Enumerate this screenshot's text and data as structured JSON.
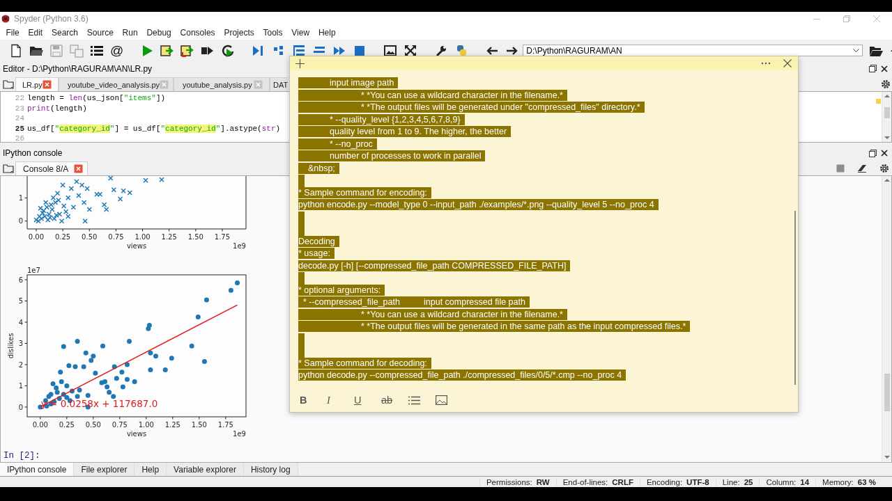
{
  "window": {
    "title": "Spyder (Python 3.6)"
  },
  "menu": [
    "File",
    "Edit",
    "Search",
    "Source",
    "Run",
    "Debug",
    "Consoles",
    "Projects",
    "Tools",
    "View",
    "Help"
  ],
  "toolbar": {
    "glyph": "@",
    "working_directory": "D:\\Python\\RAGURAM\\AN"
  },
  "editor": {
    "title": "Editor - D:\\Python\\RAGURAM\\AN\\LR.py",
    "tabs": [
      {
        "label": "LR.py",
        "selected": true
      },
      {
        "label": "youtube_video_analysis.py",
        "selected": false
      },
      {
        "label": "youtube_analysis.py",
        "selected": false
      },
      {
        "label": "DAT",
        "selected": false,
        "kind": "truncated"
      }
    ],
    "lines": [
      {
        "number": "22",
        "current": false,
        "tokens": [
          {
            "text": "length = ",
            "kind": "plain"
          },
          {
            "text": "len",
            "kind": "builtin"
          },
          {
            "text": "(us_json[",
            "kind": "plain"
          },
          {
            "text": "\"items\"",
            "kind": "string"
          },
          {
            "text": "])",
            "kind": "plain"
          }
        ]
      },
      {
        "number": "23",
        "current": false,
        "tokens": [
          {
            "text": "print",
            "kind": "builtin"
          },
          {
            "text": "(length)",
            "kind": "plain"
          }
        ]
      },
      {
        "number": "24",
        "current": false
      },
      {
        "number": "25",
        "current": true,
        "tokens": [
          {
            "text": "us_df[",
            "kind": "plain"
          },
          {
            "text": "\"",
            "kind": "string"
          },
          {
            "text": "category_id",
            "kind": "occurrence"
          },
          {
            "text": "\"",
            "kind": "string"
          },
          {
            "text": "] = us_df[",
            "kind": "plain"
          },
          {
            "text": "\"",
            "kind": "string"
          },
          {
            "text": "category_id",
            "kind": "occurrence"
          },
          {
            "text": "\"",
            "kind": "string"
          },
          {
            "text": "].astype(",
            "kind": "plain"
          },
          {
            "text": "str",
            "kind": "builtin"
          },
          {
            "text": ")",
            "kind": "plain"
          }
        ]
      },
      {
        "number": "26",
        "current": false
      }
    ]
  },
  "console": {
    "title": "IPython console",
    "tabs": [
      {
        "label": "Console 8/A",
        "selected": true
      }
    ],
    "plots": [
      {
        "x_offset": "1e9",
        "chart_data": {
          "type": "scatter",
          "xlabel": "views",
          "xlim": [
            -0.085,
            1.973
          ],
          "ylim": [
            -0.34,
            1.94
          ],
          "xticks": [
            {
              "value": 0,
              "label": "0.00"
            },
            {
              "value": 0.25,
              "label": "0.25"
            },
            {
              "value": 0.5,
              "label": "0.50"
            },
            {
              "value": 0.75,
              "label": "0.75"
            },
            {
              "value": 1,
              "label": "1.00"
            },
            {
              "value": 1.25,
              "label": "1.25"
            },
            {
              "value": 1.5,
              "label": "1.50"
            },
            {
              "value": 1.75,
              "label": "1.75"
            }
          ],
          "yticks": [
            0,
            1
          ],
          "series": [
            {
              "color": "#1f77b4",
              "marker": "x",
              "x": [
                1.03,
                1.18,
                0.88,
                0.82,
                0.79,
                0.73,
                0.66,
                0.64,
                0.6,
                0.57,
                0.5,
                0.46,
                0.45,
                0.4,
                0.35,
                0.3,
                0.25,
                0.2,
                0.18,
                0.15,
                0.12,
                0.1,
                0.08,
                0.05,
                0.02,
                0.0,
                0.22,
                0.28,
                0.33,
                0.38,
                0.43,
                0.48,
                0.7,
                0.16,
                0.06,
                0.13,
                0.24,
                0.3,
                0.03,
                0.07,
                0.11,
                0.14,
                0.19,
                0.09,
                0.04,
                0.26,
                0.21,
                0.17
              ],
              "values": [
                1.75,
                1.78,
                1.22,
                1.3,
                0.95,
                1.35,
                0.5,
                0.7,
                1.15,
                1.15,
                0.5,
                0.0,
                0.8,
                1.1,
                0.6,
                1.0,
                1.55,
                1.2,
                0.8,
                0.5,
                0.3,
                0.6,
                0.2,
                0.1,
                0.0,
                0.05,
                0.3,
                0.4,
                1.4,
                1.7,
                1.55,
                1.4,
                1.85,
                1.0,
                0.35,
                0.15,
                0.0,
                0.2,
                0.2,
                0.45,
                0.05,
                0.7,
                0.25,
                0.8,
                0.55,
                0.65,
                0.9,
                0.1
              ]
            }
          ]
        }
      },
      {
        "x_offset": "1e9",
        "y_offset": "1e7",
        "chart_data": {
          "type": "scatter",
          "xlabel": "views",
          "ylabel": "dislikes",
          "xlim": [
            -0.124,
            1.942
          ],
          "ylim": [
            -0.46,
            6.23
          ],
          "xticks": [
            {
              "value": 0,
              "label": "0.00"
            },
            {
              "value": 0.25,
              "label": "0.25"
            },
            {
              "value": 0.5,
              "label": "0.50"
            },
            {
              "value": 0.75,
              "label": "0.75"
            },
            {
              "value": 1,
              "label": "1.00"
            },
            {
              "value": 1.25,
              "label": "1.25"
            },
            {
              "value": 1.5,
              "label": "1.50"
            },
            {
              "value": 1.75,
              "label": "1.75"
            }
          ],
          "yticks": [
            0,
            1,
            2,
            3,
            4,
            5,
            6
          ],
          "series": [
            {
              "color": "#1f77b4",
              "marker": "o",
              "x": [
                1.86,
                1.8,
                1.57,
                1.49,
                1.03,
                1.02,
                0.84,
                0.35,
                0.22,
                0.59,
                1.43,
                1.55,
                1.24,
                1.09,
                1.04,
                0.43,
                0.5,
                0.48,
                0.19,
                0.27,
                0.33,
                0.41,
                0.52,
                0.7,
                0.82,
                0.77,
                1.04,
                1.18,
                0.58,
                0.61,
                0.72,
                0.82,
                0.89,
                0.78,
                0.63,
                0.65,
                0.69,
                0.45,
                0.37,
                0.3,
                0.25,
                0.2,
                0.15,
                0.1,
                0.12,
                0.05,
                0.08,
                0.02,
                0.0,
                0.04,
                0.18,
                0.22,
                0.28,
                0.35,
                0.45,
                0.13,
                0.06,
                0.1,
                0.16,
                0.25
              ],
              "values": [
                5.85,
                5.5,
                5.05,
                4.25,
                3.85,
                3.7,
                3.1,
                3.1,
                2.85,
                2.88,
                2.88,
                2.15,
                2.3,
                2.4,
                2.55,
                2.55,
                2.4,
                2.2,
                1.65,
                1.95,
                1.9,
                1.9,
                1.6,
                1.9,
                2.0,
                1.65,
                1.75,
                1.75,
                1.15,
                1.2,
                1.35,
                1.3,
                1.2,
                0.95,
                0.95,
                0.7,
                0.5,
                0.55,
                0.8,
                0.75,
                1.0,
                1.2,
                0.9,
                0.6,
                1.1,
                0.3,
                0.5,
                null,
                0.0,
                null,
                0.4,
                0.6,
                0.3,
                0.5,
                0.0,
                0.25,
                0.05,
                0.15,
                0.7,
                0.45
              ]
            },
            {
              "color": "#e31a1c",
              "type": "line",
              "x": [
                0,
                1.86
              ],
              "values": [
                0.01,
                4.81
              ]
            }
          ],
          "annotations": [
            {
              "text": "y = 0.0258x + 117687.0",
              "x": 0.0,
              "y": 0.0
            }
          ]
        }
      }
    ],
    "prompt": "In [2]:"
  },
  "bottom_tabs": [
    {
      "label": "IPython console",
      "selected": true
    },
    {
      "label": "File explorer",
      "selected": false
    },
    {
      "label": "Help",
      "selected": false
    },
    {
      "label": "Variable explorer",
      "selected": false
    },
    {
      "label": "History log",
      "selected": false
    }
  ],
  "status_bar": [
    {
      "label": "Permissions:",
      "value": "RW"
    },
    {
      "label": "End-of-lines:",
      "value": "CRLF"
    },
    {
      "label": "Encoding:",
      "value": "UTF-8"
    },
    {
      "label": "Line:",
      "value": "25"
    },
    {
      "label": "Column:",
      "value": "14"
    },
    {
      "label": "Memory:",
      "value": "63 %"
    }
  ],
  "note": {
    "lines": [
      {
        "text": "\tinput image path",
        "selected": true
      },
      {
        "text": "\t\t* *You can use a wildcard character in the filename.*",
        "selected": true
      },
      {
        "text": "\t\t* *The output files will be generated under \"compressed_files\" directory.*",
        "selected": true
      },
      {
        "text": "\t* --quality_level {1,2,3,4,5,6,7,8,9}",
        "selected": true
      },
      {
        "text": "\tquality level from 1 to 9. The higher, the better",
        "selected": true
      },
      {
        "text": "\t* --no_proc",
        "selected": true
      },
      {
        "text": "\tnumber of processes to work in parallel",
        "selected": true
      },
      {
        "text": "    &nbsp;",
        "selected": true
      },
      {
        "kind": "blank",
        "selected": true
      },
      {
        "text": "* Sample command for encoding:",
        "selected": true
      },
      {
        "text": "python encode.py --model_type 0 --input_path ./examples/*.png --quality_level 5 --no_proc 4",
        "selected": true
      },
      {
        "kind": "blank",
        "selected": true
      },
      {
        "kind": "blank",
        "selected": true
      },
      {
        "text": "Decoding",
        "selected": true
      },
      {
        "text": "* usage:",
        "selected": true
      },
      {
        "text": "decode.py [-h] [--compressed_file_path COMPRESSED_FILE_PATH]",
        "selected": true
      },
      {
        "kind": "blank",
        "selected": true
      },
      {
        "text": "* optional arguments:",
        "selected": true
      },
      {
        "text": "  * --compressed_file_path\tinput compressed file path",
        "selected": true
      },
      {
        "text": "\t\t* *You can use a wildcard character in the filename.*",
        "selected": true
      },
      {
        "text": "\t\t* *The output files will be generated in the same path as the input compressed files.*",
        "selected": true
      },
      {
        "kind": "blank",
        "selected": true
      },
      {
        "kind": "blank",
        "selected": true
      },
      {
        "text": "* Sample command for decoding:",
        "selected": true
      },
      {
        "text": "python decode.py --compressed_file_path ./compressed_files/0/5/*.cmp --no_proc 4",
        "selected": true
      }
    ],
    "format_buttons": [
      {
        "label": "B",
        "kind": "bold"
      },
      {
        "label": "I",
        "kind": "italic"
      },
      {
        "label": "U",
        "kind": "underline"
      },
      {
        "label": "ab",
        "kind": "strike"
      }
    ]
  }
}
